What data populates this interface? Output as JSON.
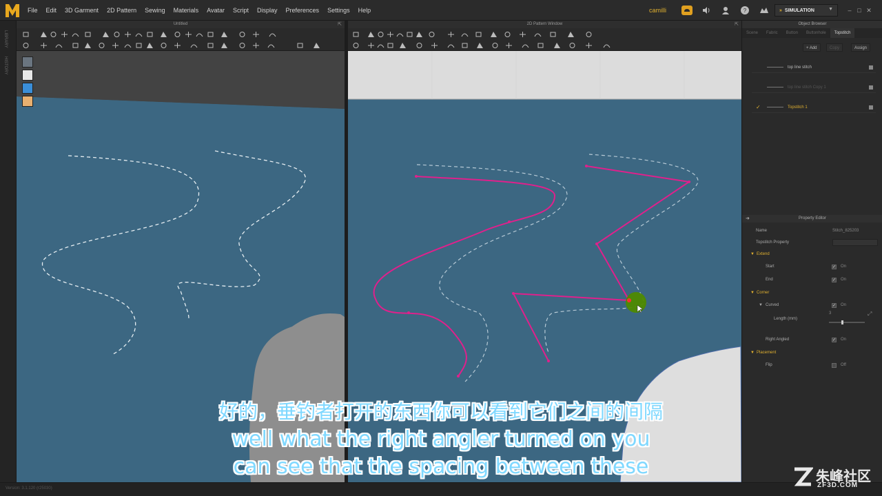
{
  "app": {
    "logo_letter": "M",
    "menu": [
      "File",
      "Edit",
      "3D Garment",
      "2D Pattern",
      "Sewing",
      "Materials",
      "Avatar",
      "Script",
      "Display",
      "Preferences",
      "Settings",
      "Help"
    ],
    "user": "camilli",
    "mode": "SIMULATION",
    "accent_color": "#e0b030",
    "magenta": "#e0208c"
  },
  "side_dock": {
    "labels": [
      "LIBRARY",
      "HISTORY"
    ]
  },
  "window_3d": {
    "title": "Untitled"
  },
  "window_2d": {
    "title": "2D Pattern Window"
  },
  "object_browser": {
    "title": "Object Browser",
    "tabs": [
      "Scene",
      "Fabric",
      "Button",
      "Buttonhole",
      "Topstitch"
    ],
    "active_tab": "Topstitch",
    "actions": {
      "add": "+ Add",
      "copy": "Copy",
      "assign": "Assign"
    },
    "items": [
      {
        "label": "top line stitch"
      },
      {
        "label": "top line stitch Copy 1"
      },
      {
        "label": "Topstitch 1",
        "selected": true
      }
    ]
  },
  "property_editor": {
    "title": "Property Editor",
    "name_key": "Name",
    "name_value": "Stitch_825203",
    "topstitch_property": "Topstitch Property",
    "sections": {
      "extend": "Extend",
      "start": "Start",
      "end": "End",
      "corner": "Corner",
      "curved": "Curved",
      "length": "Length (mm)",
      "length_value": "3",
      "right_angled": "Right Angled",
      "placement": "Placement",
      "flip": "Flip"
    },
    "values": {
      "on": "On",
      "off": "Off"
    },
    "slider_level": 0.35
  },
  "statusbar": {
    "text": "Version: 3.1.120  (r25030)"
  },
  "subtitles": {
    "zh": "好的，垂钓者打开的东西你可以看到它们之间的间隔",
    "en1": "well what the right angler turned on you",
    "en2": "can see that the spacing between these"
  },
  "watermark": {
    "brand": "朱峰社区",
    "url": "ZF3D.COM"
  }
}
